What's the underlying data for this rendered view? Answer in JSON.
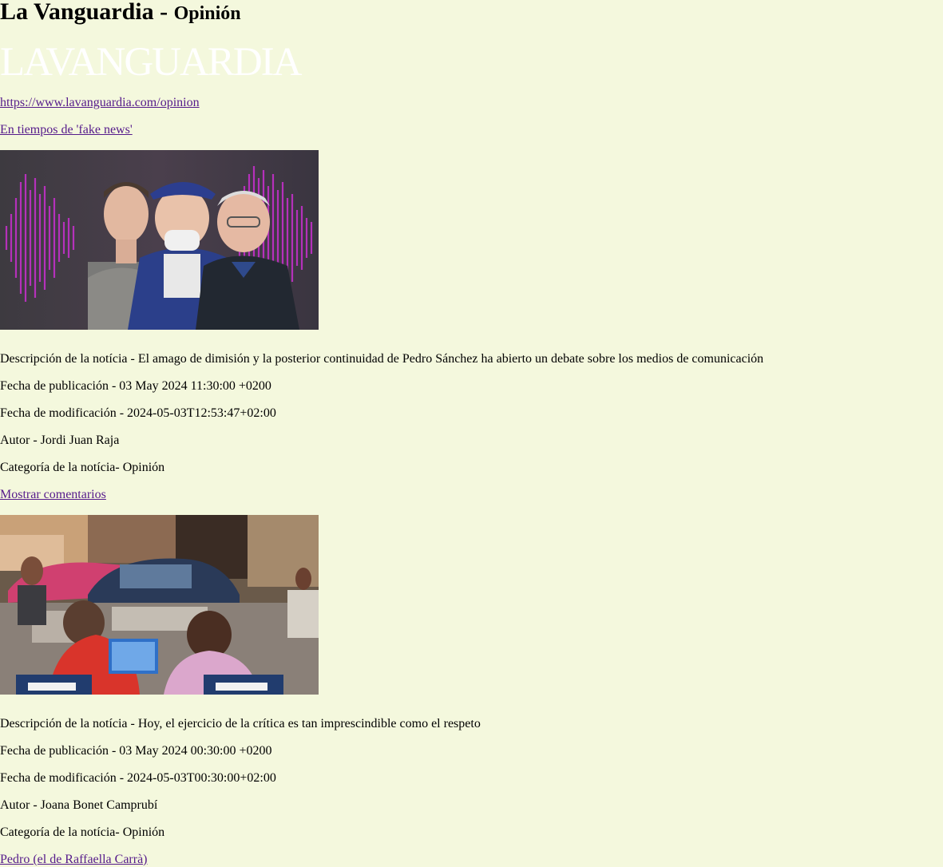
{
  "header": {
    "title_main": "La Vanguardia - ",
    "title_sub": "Opinión",
    "logo_text": "LAVANGUARDIA",
    "feed_link": "https://www.lavanguardia.com/opinion"
  },
  "articles": [
    {
      "title": "En tiempos de 'fake news'",
      "image": "article-1-photo",
      "description": "Descripción de la notícia - El amago de dimisión y la posterior continuidad de Pedro Sánchez ha abierto un debate sobre los medios de comunicación",
      "pub_date": "Fecha de publicación - 03 May 2024 11:30:00 +0200",
      "mod_date": "Fecha de modificación - 2024-05-03T12:53:47+02:00",
      "author": "Autor - Jordi Juan Raja",
      "category": "Categoría de la notícia- Opinión"
    },
    {
      "title": "Mostrar comentarios",
      "image": "article-2-photo",
      "description": "Descripción de la notícia - Hoy, el ejercicio de la crítica es tan imprescindible como el respeto",
      "pub_date": "Fecha de publicación - 03 May 2024 00:30:00 +0200",
      "mod_date": "Fecha de modificación - 2024-05-03T00:30:00+02:00",
      "author": "Autor - Joana Bonet Camprubí",
      "category": "Categoría de la notícia- Opinión"
    },
    {
      "title": "Pedro (el de Raffaella Carrà)"
    }
  ],
  "colors": {
    "page_background": "#f4f8dd",
    "link": "#551a8b"
  }
}
